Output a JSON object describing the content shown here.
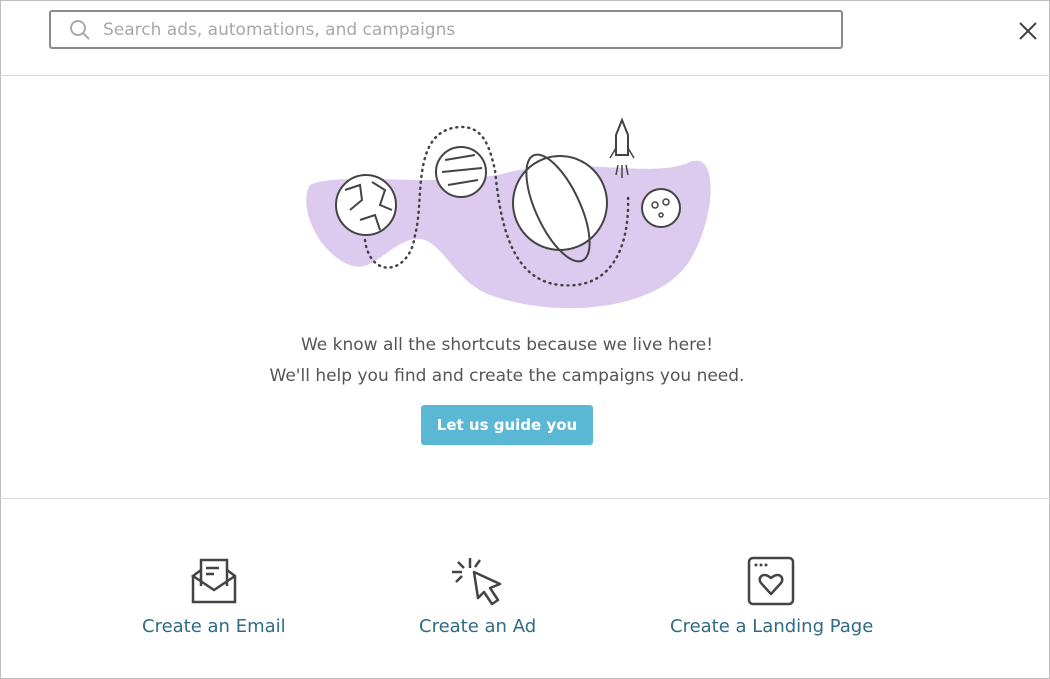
{
  "search": {
    "placeholder": "Search ads, automations, and campaigns",
    "icon": "search-icon"
  },
  "close": {
    "icon": "close-icon"
  },
  "message": {
    "line1": "We know all the shortcuts because we live here!",
    "line2": "We'll help you find and create the campaigns you need."
  },
  "guide_button": {
    "label": "Let us guide you"
  },
  "shortcuts": [
    {
      "label": "Create an Email",
      "icon": "email-icon"
    },
    {
      "label": "Create an Ad",
      "icon": "cursor-click-icon"
    },
    {
      "label": "Create a Landing Page",
      "icon": "landing-page-icon"
    }
  ],
  "colors": {
    "accent": "#5bb8d4",
    "link": "#2f6b85",
    "blob": "#dccbef"
  }
}
